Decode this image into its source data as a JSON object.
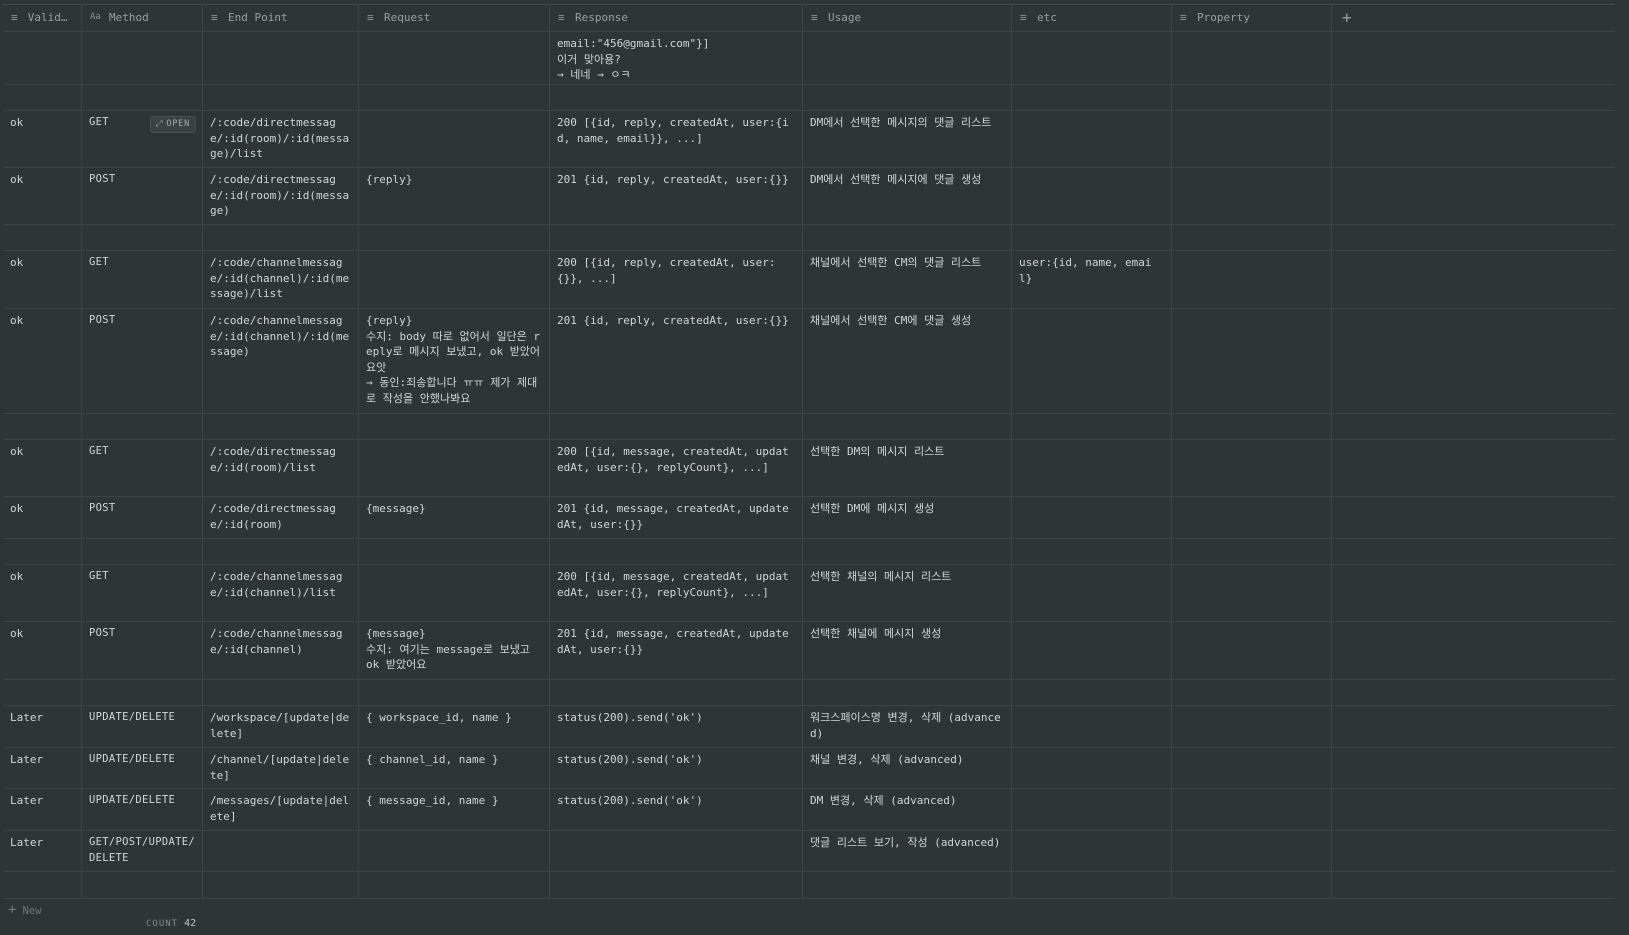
{
  "columns": [
    {
      "label": "Validi…",
      "icon": "text-icon"
    },
    {
      "label": "Method",
      "icon": "title-icon"
    },
    {
      "label": "End Point",
      "icon": "text-icon"
    },
    {
      "label": "Request",
      "icon": "text-icon"
    },
    {
      "label": "Response",
      "icon": "text-icon"
    },
    {
      "label": "Usage",
      "icon": "text-icon"
    },
    {
      "label": "etc",
      "icon": "text-icon"
    },
    {
      "label": "Property",
      "icon": "text-icon"
    }
  ],
  "add_column": "+",
  "open_label": "OPEN",
  "rows": [
    {
      "cells": [
        "",
        "",
        "",
        "",
        "email:\"456@gmail.com\"}]\n이거 맞아용?\n→ 네네 → ㅇㅋ",
        "",
        "",
        ""
      ],
      "h": 53
    },
    {
      "cells": [
        "",
        "",
        "",
        "",
        "",
        "",
        "",
        ""
      ],
      "h": 26
    },
    {
      "cells": [
        "ok",
        "GET",
        "/:code/directmessage/:id(room)/:id(message)/list",
        "",
        "200 [{id, reply, createdAt, user:{id, name, email}}, ...]",
        "DM에서 선택한 메시지의 댓글 리스트",
        "",
        ""
      ],
      "h": 57,
      "open": true
    },
    {
      "cells": [
        "ok",
        "POST",
        "/:code/directmessage/:id(room)/:id(message)",
        "{reply}",
        "201 {id, reply, createdAt, user:{}}",
        "DM에서 선택한 메시지에 댓글 생성",
        "",
        ""
      ],
      "h": 57
    },
    {
      "cells": [
        "",
        "",
        "",
        "",
        "",
        "",
        "",
        ""
      ],
      "h": 26
    },
    {
      "cells": [
        "ok",
        "GET",
        "/:code/channelmessage/:id(channel)/:id(message)/list",
        "",
        "200 [{id, reply, createdAt, user:{}}, ...]",
        "채널에서 선택한 CM의 댓글 리스트",
        "user:{id, name, email}",
        ""
      ],
      "h": 58
    },
    {
      "cells": [
        "ok",
        "POST",
        "/:code/channelmessage/:id(channel)/:id(message)",
        "{reply}\n수지: body 따로 없어서 일단은 reply로 메시지 보냈고, ok 받았어요앗\n→ 동인:죄송합니다 ㅠㅠ 제가 제대로 작성을 안했나봐요",
        "201 {id, reply, createdAt, user:{}}",
        "채널에서 선택한 CM에 댓글 생성",
        "",
        ""
      ],
      "h": 105
    },
    {
      "cells": [
        "",
        "",
        "",
        "",
        "",
        "",
        "",
        ""
      ],
      "h": 26
    },
    {
      "cells": [
        "ok",
        "GET",
        "/:code/directmessage/:id(room)/list",
        "",
        "200 [{id, message, createdAt, updatedAt, user:{}, replyCount}, ...]",
        "선택한 DM의 메시지 리스트",
        "",
        ""
      ],
      "h": 57
    },
    {
      "cells": [
        "ok",
        "POST",
        "/:code/directmessage/:id(room)",
        "{message}",
        "201 {id, message, createdAt, updatedAt, user:{}}",
        "선택한 DM에 메시지 생성",
        "",
        ""
      ],
      "h": 42
    },
    {
      "cells": [
        "",
        "",
        "",
        "",
        "",
        "",
        "",
        ""
      ],
      "h": 26
    },
    {
      "cells": [
        "ok",
        "GET",
        "/:code/channelmessage/:id(channel)/list",
        "",
        "200 [{id, message, createdAt, updatedAt, user:{}, replyCount}, ...]",
        "선택한 채널의 메시지 리스트",
        "",
        ""
      ],
      "h": 57
    },
    {
      "cells": [
        "ok",
        "POST",
        "/:code/channelmessage/:id(channel)",
        "{message}\n수지: 여기는 message로 보냈고 ok 받았어요",
        "201 {id, message, createdAt, updatedAt, user:{}}",
        "선택한 채널에 메시지 생성",
        "",
        ""
      ],
      "h": 58
    },
    {
      "cells": [
        "",
        "",
        "",
        "",
        "",
        "",
        "",
        ""
      ],
      "h": 26
    },
    {
      "cells": [
        "Later",
        "UPDATE/DELETE",
        "/workspace/[update|delete]",
        "{ workspace_id, name }",
        "status(200).send('ok')",
        "워크스페이스명 변경, 삭제 (advanced)",
        "",
        ""
      ],
      "h": 42
    },
    {
      "cells": [
        "Later",
        "UPDATE/DELETE",
        "/channel/[update|delete]",
        "{ channel_id, name }",
        "status(200).send('ok')",
        "채널 변경, 삭제 (advanced)",
        "",
        ""
      ],
      "h": 41
    },
    {
      "cells": [
        "Later",
        "UPDATE/DELETE",
        "/messages/[update|delete]",
        "{ message_id, name }",
        "status(200).send('ok')",
        "DM 변경, 삭제 (advanced)",
        "",
        ""
      ],
      "h": 42
    },
    {
      "cells": [
        "Later",
        "GET/POST/UPDATE/DELETE",
        "",
        "",
        "",
        "댓글 리스트 보기, 작성 (advanced)",
        "",
        ""
      ],
      "h": 41
    },
    {
      "cells": [
        "",
        "",
        "",
        "",
        "",
        "",
        "",
        ""
      ],
      "h": 27
    }
  ],
  "footer": {
    "new_label": "New",
    "count_label": "COUNT",
    "count_value": "42"
  }
}
